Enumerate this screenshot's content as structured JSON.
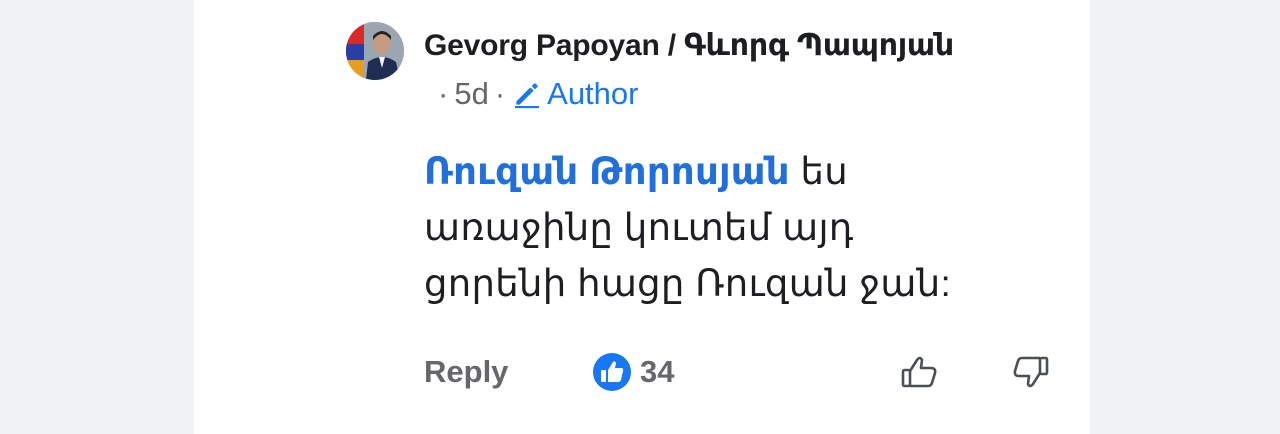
{
  "comment": {
    "author": "Gevorg Papoyan / Գևորգ Պապոյան",
    "age": "5d",
    "separator": "·",
    "badge_label": "Author",
    "mention": "Ռուզան Թորոսյան",
    "text_lines": [
      " ես",
      "առաջինը կուտեմ  այդ",
      "ցորենի հացը Ռուզան ջան:"
    ]
  },
  "actions": {
    "reply_label": "Reply",
    "reaction_count": "34",
    "reaction_icon": "like-reaction-icon",
    "like_icon": "thumbs-up-icon",
    "dislike_icon": "thumbs-down-icon"
  },
  "colors": {
    "link_blue": "#216fdb",
    "accent_blue": "#1877f2",
    "muted_gray": "#65676b",
    "text": "#1c1e21",
    "background": "#f0f2f5"
  }
}
